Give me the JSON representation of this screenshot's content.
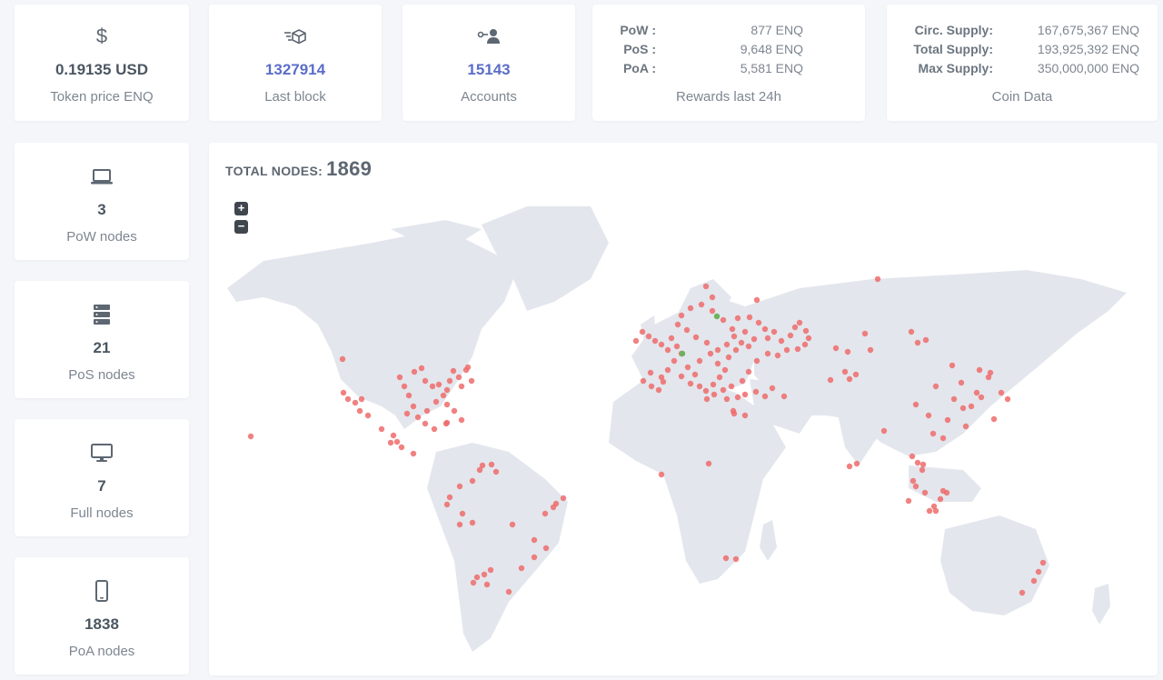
{
  "top": {
    "token_price": {
      "icon": "dollar-icon",
      "value": "0.19135 USD",
      "label": "Token price ENQ"
    },
    "last_block": {
      "icon": "block-cube-icon",
      "value": "1327914",
      "label": "Last block"
    },
    "accounts": {
      "icon": "account-key-icon",
      "value": "15143",
      "label": "Accounts"
    },
    "rewards": {
      "rows": [
        {
          "key": "PoW :",
          "value": "877 ENQ"
        },
        {
          "key": "PoS :",
          "value": "9,648 ENQ"
        },
        {
          "key": "PoA :",
          "value": "5,581 ENQ"
        }
      ],
      "label": "Rewards last 24h"
    },
    "coin": {
      "rows": [
        {
          "key": "Circ. Supply:",
          "value": "167,675,367 ENQ"
        },
        {
          "key": "Total Supply:",
          "value": "193,925,392 ENQ"
        },
        {
          "key": "Max Supply:",
          "value": "350,000,000 ENQ"
        }
      ],
      "label": "Coin Data"
    }
  },
  "side": {
    "pow": {
      "icon": "laptop-icon",
      "value": "3",
      "label": "PoW nodes"
    },
    "pos": {
      "icon": "server-icon",
      "value": "21",
      "label": "PoS nodes"
    },
    "full": {
      "icon": "monitor-icon",
      "value": "7",
      "label": "Full nodes"
    },
    "poa": {
      "icon": "phone-icon",
      "value": "1838",
      "label": "PoA nodes"
    }
  },
  "map": {
    "title": "TOTAL NODES:",
    "total": "1869",
    "zoom_in": "+",
    "zoom_out": "−",
    "land_color": "#e3e7ed",
    "node_color": "#ef6b6b",
    "special_node_color": "#6bb35e"
  }
}
